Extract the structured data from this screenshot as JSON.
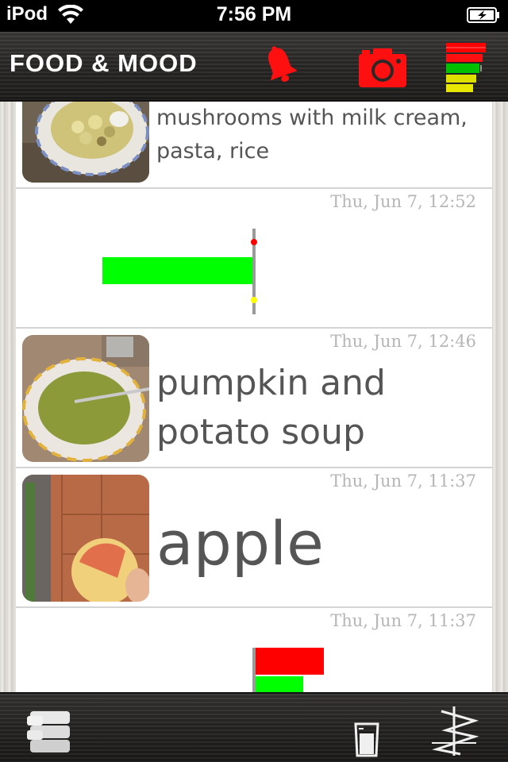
{
  "status_bar": {
    "carrier": "iPod",
    "time": "7:56 PM"
  },
  "nav": {
    "title": "FOOD & MOOD",
    "icons": [
      "bell-icon",
      "camera-icon",
      "mood-bars-icon"
    ],
    "colors": {
      "red": "#ff0000",
      "green": "#00cc00",
      "yellow": "#e8e800"
    }
  },
  "feed": {
    "entries": [
      {
        "type": "food",
        "timestamp": "",
        "text_lines": [
          "mushrooms with milk cream,",
          "pasta, rice"
        ],
        "image": "pasta-plate-photo"
      },
      {
        "type": "mood",
        "timestamp": "Thu, Jun 7, 12:52",
        "bar_color": "#00ff00",
        "markers": [
          "#ff0000",
          "#ffff00"
        ]
      },
      {
        "type": "food",
        "timestamp": "Thu, Jun 7, 12:46",
        "text_lines": [
          "pumpkin and",
          "potato soup"
        ],
        "image": "soup-bowl-photo"
      },
      {
        "type": "food",
        "timestamp": "Thu, Jun 7, 11:37",
        "text_lines": [
          "apple"
        ],
        "image": "apple-photo"
      },
      {
        "type": "mood",
        "timestamp": "Thu, Jun 7, 11:37",
        "bar_colors": [
          "#ff0000",
          "#00ff00"
        ]
      }
    ]
  },
  "toolbar": {
    "icons": [
      "database-stack-icon",
      "measuring-glass-icon",
      "graph-icon"
    ]
  }
}
